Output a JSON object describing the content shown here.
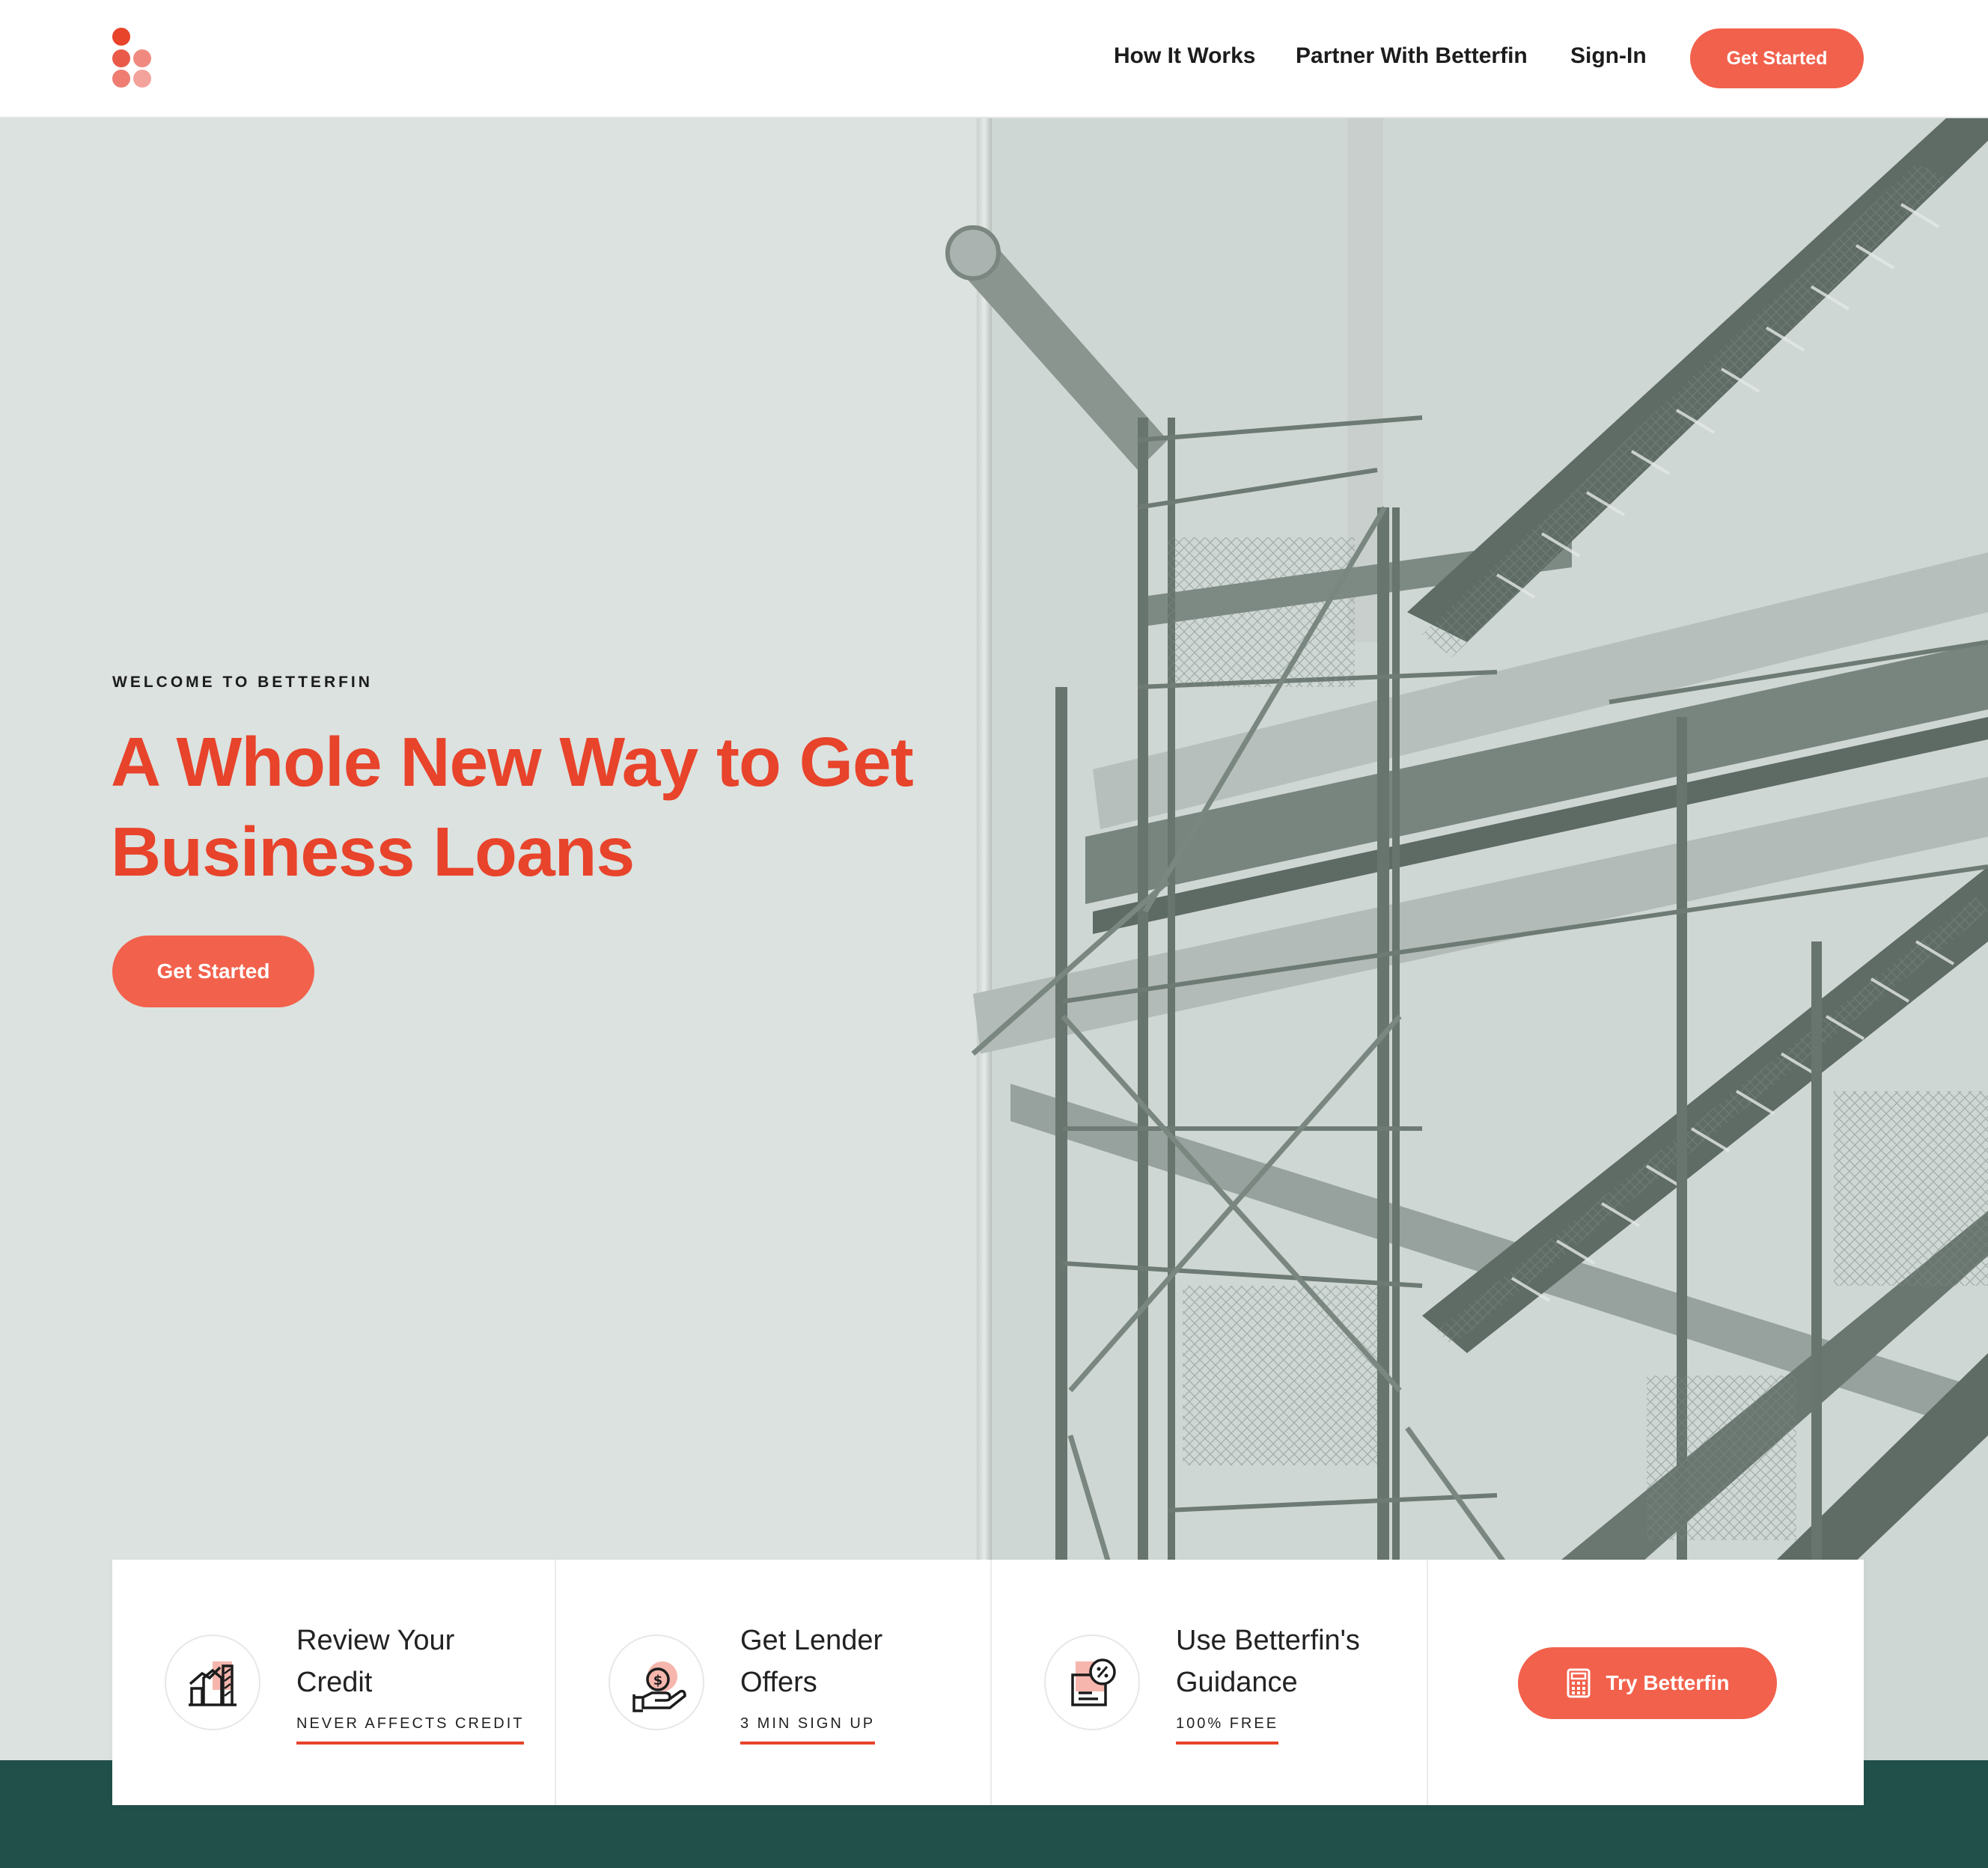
{
  "header": {
    "logo_icon": "betterfin-dots-logo",
    "nav": [
      {
        "label": "How It Works"
      },
      {
        "label": "Partner With Betterfin"
      },
      {
        "label": "Sign-In"
      }
    ],
    "cta_label": "Get Started"
  },
  "hero": {
    "eyebrow": "WELCOME TO BETTERFIN",
    "headline_line1": "A Whole New Way to Get",
    "headline_line2": "Business Loans",
    "cta_label": "Get Started",
    "image_icon": "staircase-scaffold-photo"
  },
  "features": [
    {
      "icon": "credit-chart-icon",
      "title_line1": "Review Your",
      "title_line2": "Credit",
      "subtitle": "NEVER AFFECTS CREDIT"
    },
    {
      "icon": "hand-coin-icon",
      "title_line1": "Get Lender",
      "title_line2": "Offers",
      "subtitle": "3 MIN SIGN UP"
    },
    {
      "icon": "percent-document-icon",
      "title_line1": "Use Betterfin's",
      "title_line2": "Guidance",
      "subtitle": "100% FREE"
    }
  ],
  "try_button": {
    "label": "Try Betterfin",
    "icon": "calculator-icon"
  },
  "colors": {
    "accent": "#e8432b",
    "button": "#f2614c",
    "hero_bg": "#dbe2df",
    "band": "#214f4a",
    "steel": "#6f7b75"
  }
}
